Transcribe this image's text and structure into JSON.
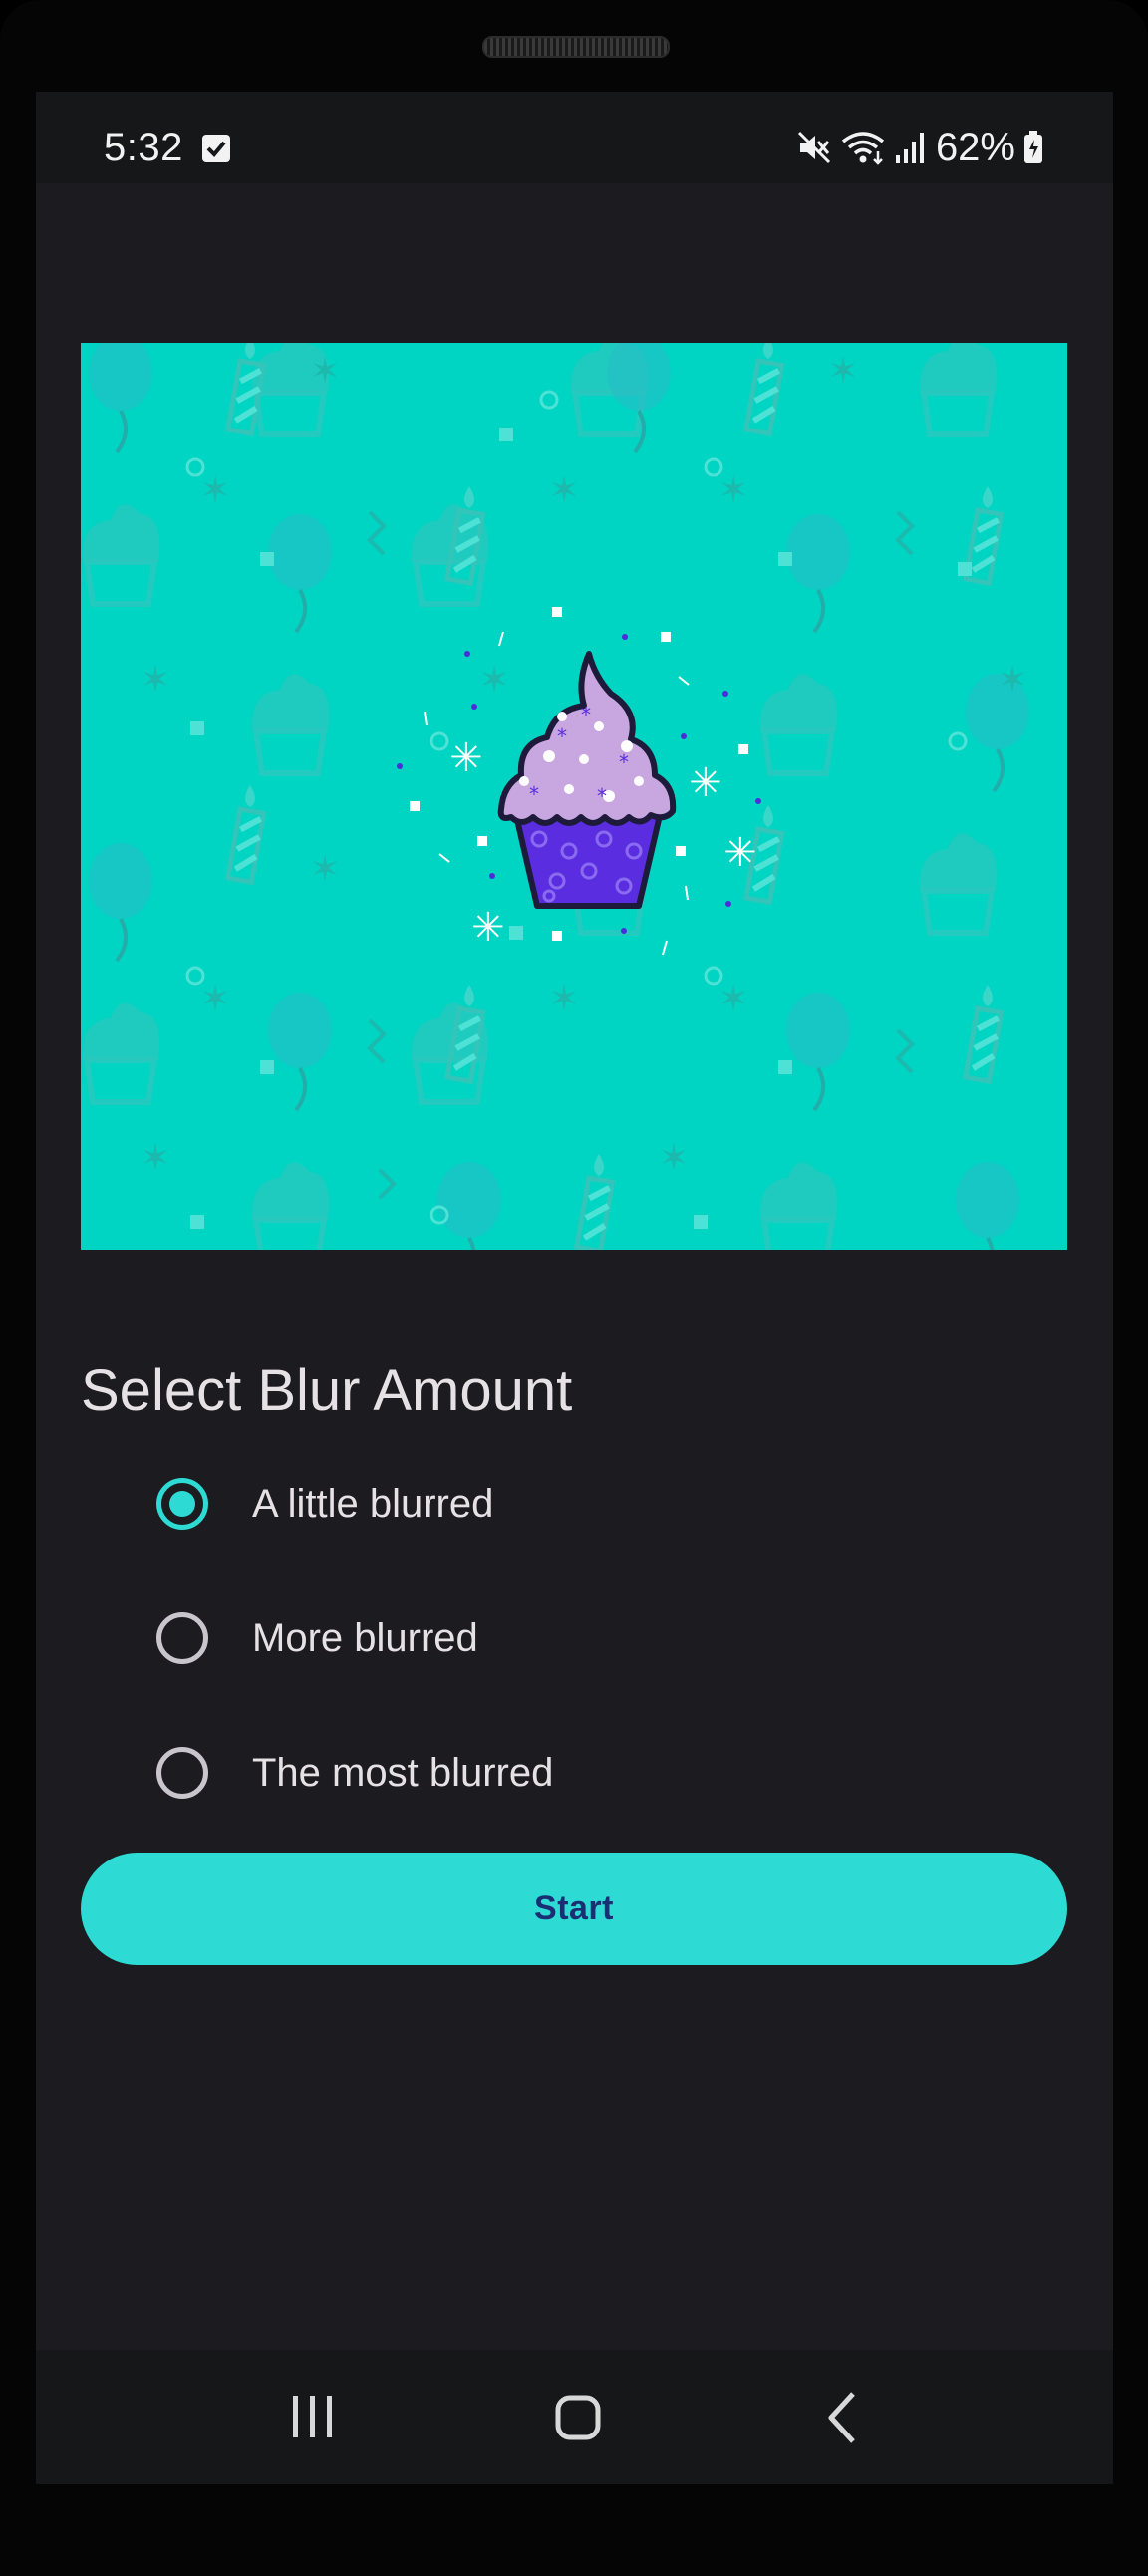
{
  "status_bar": {
    "time": "5:32",
    "battery_percent": "62%",
    "icons": [
      "checkbox-notification-icon",
      "mute-icon",
      "wifi-icon",
      "signal-icon",
      "battery-icon"
    ]
  },
  "hero_image": {
    "icon": "cupcake-icon",
    "colors": {
      "background": "#00d4c2",
      "frosting": "#c8a6e0",
      "wrapper": "#5a2ee0"
    }
  },
  "blur": {
    "title": "Select Blur Amount",
    "options": [
      {
        "label": "A little blurred",
        "selected": true
      },
      {
        "label": "More blurred",
        "selected": false
      },
      {
        "label": "The most blurred",
        "selected": false
      }
    ]
  },
  "start_button": {
    "label": "Start"
  },
  "colors": {
    "accent": "#2ddad4",
    "background": "#1c1b1f",
    "button_text": "#1a2f73"
  },
  "nav_bar": {
    "icons": [
      "recents-icon",
      "home-icon",
      "back-icon"
    ]
  }
}
